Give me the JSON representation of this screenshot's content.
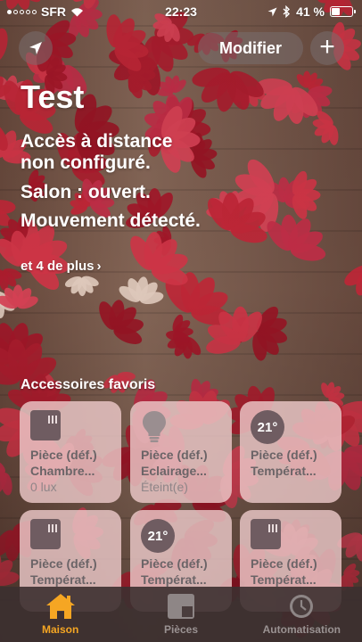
{
  "status_bar": {
    "carrier": "SFR",
    "time": "22:23",
    "battery_text": "41 %",
    "battery_level": 0.41
  },
  "header": {
    "edit_label": "Modifier",
    "add_label": "+"
  },
  "home": {
    "title": "Test",
    "status_lines": [
      "Accès à distance",
      "non configuré.",
      "Salon : ouvert.",
      "Mouvement détecté."
    ],
    "more_label": "et 4 de plus"
  },
  "favorites": {
    "title": "Accessoires favoris",
    "tiles": [
      {
        "icon": "shutter-icon",
        "room": "Pièce (déf.)",
        "name": "Chambre...",
        "state": "0 lux"
      },
      {
        "icon": "lightbulb-icon",
        "room": "Pièce (déf.)",
        "name": "Eclairage...",
        "state": "Éteint(e)"
      },
      {
        "icon": "thermostat-icon",
        "temp": "21°",
        "room": "Pièce (déf.)",
        "name": "Températ...",
        "state": ""
      },
      {
        "icon": "shutter-icon",
        "room": "Pièce (déf.)",
        "name": "Températ...",
        "state": ""
      },
      {
        "icon": "thermostat-icon",
        "temp": "21°",
        "room": "Pièce (déf.)",
        "name": "Températ...",
        "state": ""
      },
      {
        "icon": "shutter-icon",
        "room": "Pièce (déf.)",
        "name": "Températ...",
        "state": ""
      }
    ]
  },
  "tabbar": {
    "tabs": [
      {
        "label": "Maison",
        "icon": "house-icon",
        "active": true
      },
      {
        "label": "Pièces",
        "icon": "rooms-icon",
        "active": false
      },
      {
        "label": "Automatisation",
        "icon": "clock-icon",
        "active": false
      }
    ]
  },
  "colors": {
    "accent": "#f5a623",
    "tile_bg": "#ebc8c8",
    "leaf_red": "#c8283a"
  }
}
